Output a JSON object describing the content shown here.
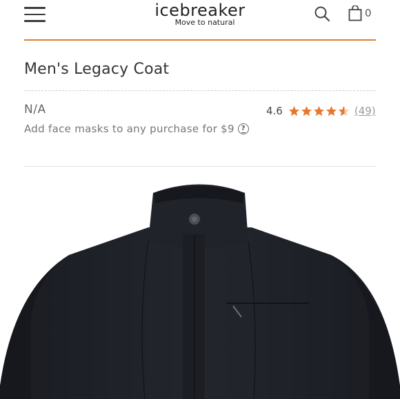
{
  "header": {
    "brand_name": "icebreaker",
    "brand_tagline": "Move to natural",
    "cart_count": "0",
    "accent_color": "#d9822b"
  },
  "product": {
    "title": "Men's Legacy Coat",
    "price": "N/A",
    "rating_value": "4.6",
    "stars": 4.6,
    "review_count": "(49)",
    "promo_text": "Add face masks to any purchase for $9",
    "help_symbol": "?",
    "image_alt": "Black men's wool coat with stand collar"
  },
  "icons": {
    "menu": "hamburger-menu-icon",
    "search": "search-icon",
    "cart": "shopping-bag-icon",
    "star": "star-icon",
    "help": "question-circle-icon"
  }
}
